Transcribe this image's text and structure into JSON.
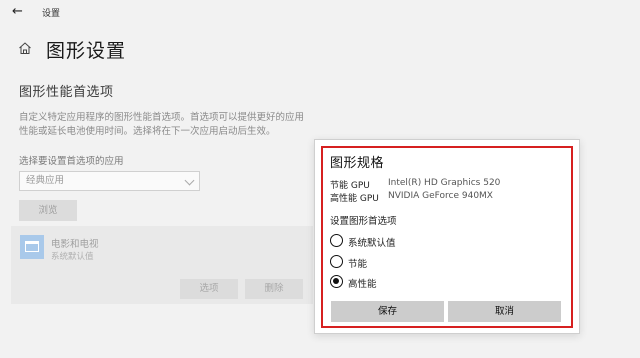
{
  "window": {
    "title": "设置"
  },
  "page": {
    "title": "图形设置"
  },
  "section": {
    "title": "图形性能首选项",
    "description": "自定义特定应用程序的图形性能首选项。首选项可以提供更好的应用性能或延长电池使用时间。选择将在下一次应用启动后生效。"
  },
  "app_picker": {
    "label": "选择要设置首选项的应用",
    "selected": "经典应用",
    "browse_label": "浏览"
  },
  "app_item": {
    "name": "电影和电视",
    "preference": "系统默认值",
    "options_label": "选项",
    "remove_label": "删除"
  },
  "dialog": {
    "title": "图形规格",
    "power_saving_label": "节能 GPU",
    "power_saving_value": "Intel(R) HD Graphics 520",
    "high_perf_label": "高性能 GPU",
    "high_perf_value": "NVIDIA GeForce 940MX",
    "pref_label": "设置图形首选项",
    "options": [
      {
        "label": "系统默认值",
        "checked": false
      },
      {
        "label": "节能",
        "checked": false
      },
      {
        "label": "高性能",
        "checked": true
      }
    ],
    "save_label": "保存",
    "cancel_label": "取消"
  },
  "colors": {
    "highlight": "#d62020",
    "app_icon": "#a9c9ea"
  }
}
